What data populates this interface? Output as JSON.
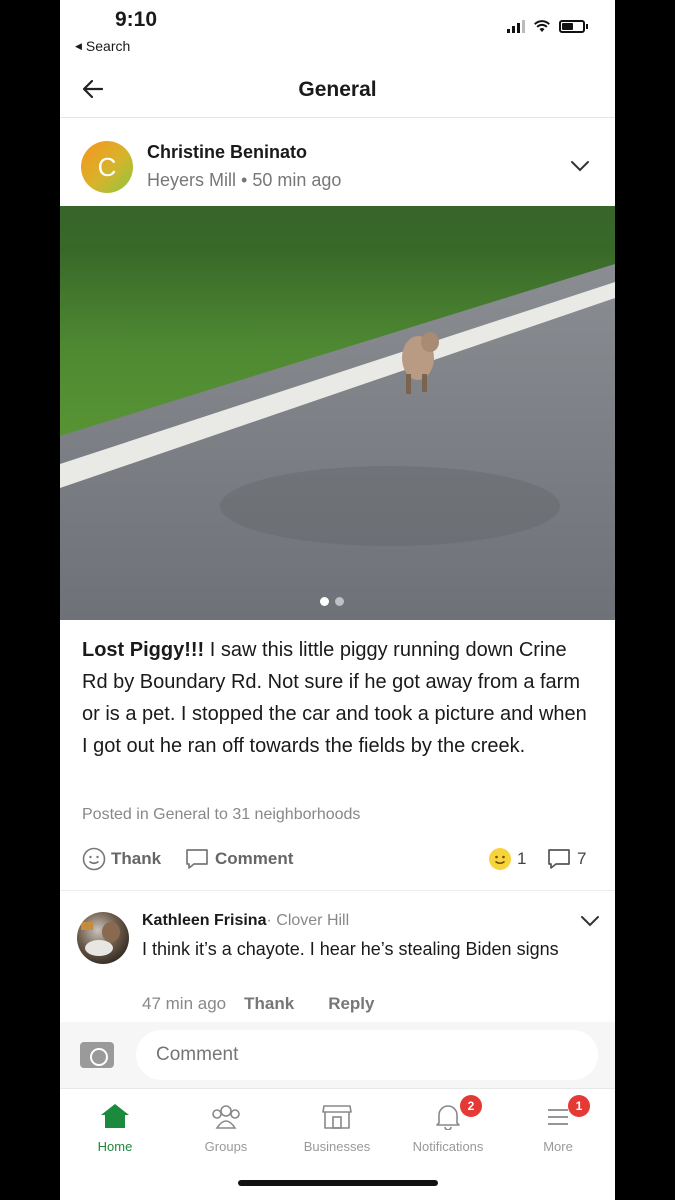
{
  "status_bar": {
    "time": "9:10",
    "back_label": "Search"
  },
  "header": {
    "title": "General"
  },
  "post": {
    "author_initial": "C",
    "author": "Christine Beninato",
    "neighborhood": "Heyers Mill",
    "separator": "•",
    "time_ago": "50 min ago",
    "title": "Lost Piggy!!!",
    "body": " I saw this little piggy running down Crine Rd by Boundary Rd.  Not sure if he got away from a farm or is a pet. I stopped the car and took a picture and when I got out he ran off towards the fields by the creek.",
    "posted_in": "Posted in General to 31 neighborhoods",
    "thank_label": "Thank",
    "comment_label": "Comment",
    "reaction_count": "1",
    "comment_count": "7"
  },
  "comment": {
    "author": "Kathleen Frisina",
    "neighborhood": "· Clover Hill",
    "text": "I think it’s a chayote.  I hear he’s stealing Biden signs",
    "time_ago": "47 min ago",
    "thank_label": "Thank",
    "reply_label": "Reply"
  },
  "composer": {
    "placeholder": "Comment"
  },
  "tabbar": {
    "items": [
      {
        "label": "Home",
        "icon": "home-icon"
      },
      {
        "label": "Groups",
        "icon": "groups-icon"
      },
      {
        "label": "Businesses",
        "icon": "businesses-icon"
      },
      {
        "label": "Notifications",
        "icon": "bell-icon",
        "badge": "2"
      },
      {
        "label": "More",
        "icon": "menu-icon",
        "badge": "1"
      }
    ]
  },
  "colors": {
    "brand_green": "#1b8a3c",
    "badge_red": "#e53935"
  }
}
